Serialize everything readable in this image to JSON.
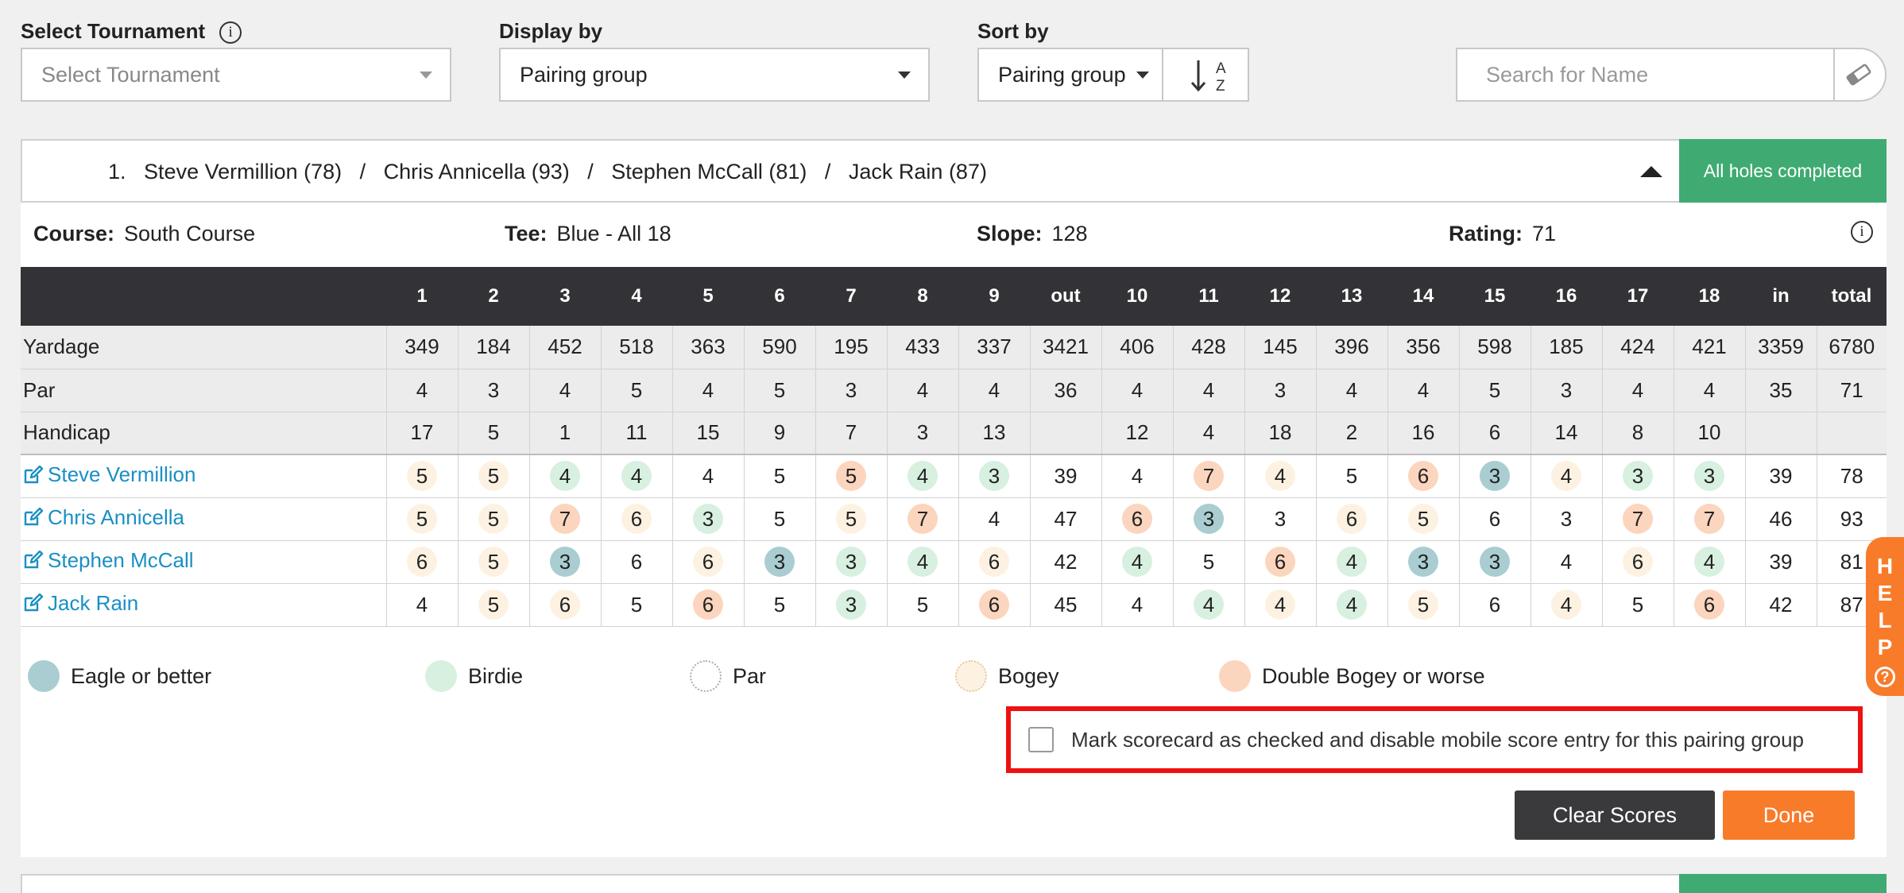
{
  "filters": {
    "tournament_label": "Select Tournament",
    "tournament_placeholder": "Select Tournament",
    "display_label": "Display by",
    "display_value": "Pairing group",
    "sort_label": "Sort by",
    "sort_value": "Pairing group",
    "sort_direction_top": "A",
    "sort_direction_bottom": "Z",
    "search_placeholder": "Search for Name"
  },
  "group": {
    "number": "1.",
    "players_line": "Steve Vermillion (78)   /   Chris Annicella (93)   /   Stephen McCall (81)   /   Jack Rain (87)",
    "status": "All holes completed"
  },
  "course_info": {
    "course_label": "Course:",
    "course_value": "South Course",
    "tee_label": "Tee:",
    "tee_value": "Blue - All 18",
    "slope_label": "Slope:",
    "slope_value": "128",
    "rating_label": "Rating:",
    "rating_value": "71"
  },
  "scorecard": {
    "columns": [
      "1",
      "2",
      "3",
      "4",
      "5",
      "6",
      "7",
      "8",
      "9",
      "out",
      "10",
      "11",
      "12",
      "13",
      "14",
      "15",
      "16",
      "17",
      "18",
      "in",
      "total"
    ],
    "info_rows": [
      {
        "label": "Yardage",
        "values": [
          "349",
          "184",
          "452",
          "518",
          "363",
          "590",
          "195",
          "433",
          "337",
          "3421",
          "406",
          "428",
          "145",
          "396",
          "356",
          "598",
          "185",
          "424",
          "421",
          "3359",
          "6780"
        ]
      },
      {
        "label": "Par",
        "values": [
          "4",
          "3",
          "4",
          "5",
          "4",
          "5",
          "3",
          "4",
          "4",
          "36",
          "4",
          "4",
          "3",
          "4",
          "4",
          "5",
          "3",
          "4",
          "4",
          "35",
          "71"
        ]
      },
      {
        "label": "Handicap",
        "values": [
          "17",
          "5",
          "1",
          "11",
          "15",
          "9",
          "7",
          "3",
          "13",
          "",
          "12",
          "4",
          "18",
          "2",
          "16",
          "6",
          "14",
          "8",
          "10",
          "",
          ""
        ]
      }
    ],
    "players": [
      {
        "name": "Steve Vermillion",
        "scores": [
          "5",
          "5",
          "4",
          "4",
          "4",
          "5",
          "5",
          "4",
          "3",
          "39",
          "4",
          "7",
          "4",
          "5",
          "6",
          "3",
          "4",
          "3",
          "3",
          "39",
          "78"
        ],
        "marks": [
          "bogey",
          "bogey",
          "birdie",
          "birdie",
          "",
          "",
          "double",
          "birdie",
          "birdie",
          "",
          "",
          "double",
          "bogey",
          "",
          "double",
          "eagle",
          "bogey",
          "birdie",
          "birdie",
          "",
          ""
        ]
      },
      {
        "name": "Chris Annicella",
        "scores": [
          "5",
          "5",
          "7",
          "6",
          "3",
          "5",
          "5",
          "7",
          "4",
          "47",
          "6",
          "3",
          "3",
          "6",
          "5",
          "6",
          "3",
          "7",
          "7",
          "46",
          "93"
        ],
        "marks": [
          "bogey",
          "bogey",
          "double",
          "bogey",
          "birdie",
          "",
          "bogey",
          "double",
          "",
          "",
          "double",
          "eagle",
          "",
          "bogey",
          "bogey",
          "",
          "",
          "double",
          "double",
          "",
          ""
        ]
      },
      {
        "name": "Stephen McCall",
        "scores": [
          "6",
          "5",
          "3",
          "6",
          "6",
          "3",
          "3",
          "4",
          "6",
          "42",
          "4",
          "5",
          "6",
          "4",
          "3",
          "3",
          "4",
          "6",
          "4",
          "39",
          "81"
        ],
        "marks": [
          "bogey",
          "bogey",
          "eagle",
          "",
          "bogey",
          "eagle",
          "birdie",
          "birdie",
          "bogey",
          "",
          "birdie",
          "",
          "double",
          "birdie",
          "eagle",
          "eagle",
          "",
          "bogey",
          "birdie",
          "",
          ""
        ]
      },
      {
        "name": "Jack Rain",
        "scores": [
          "4",
          "5",
          "6",
          "5",
          "6",
          "5",
          "3",
          "5",
          "6",
          "45",
          "4",
          "4",
          "4",
          "4",
          "5",
          "6",
          "4",
          "5",
          "6",
          "42",
          "87"
        ],
        "marks": [
          "",
          "bogey",
          "bogey",
          "",
          "double",
          "",
          "birdie",
          "",
          "double",
          "",
          "",
          "birdie",
          "bogey",
          "birdie",
          "bogey",
          "",
          "bogey",
          "",
          "double",
          "",
          ""
        ]
      }
    ]
  },
  "legend": {
    "eagle": "Eagle or better",
    "birdie": "Birdie",
    "par": "Par",
    "bogey": "Bogey",
    "double": "Double Bogey or worse"
  },
  "actions": {
    "mark_checked_label": "Mark scorecard as checked and disable mobile score entry for this pairing group",
    "mark_checked": false,
    "clear_label": "Clear Scores",
    "done_label": "Done"
  },
  "help": {
    "letters": [
      "H",
      "E",
      "L",
      "P"
    ],
    "icon": "question-icon"
  },
  "colors": {
    "eagle": "#a9cdd1",
    "birdie": "#d7f0e0",
    "bogey": "#fdf2e2",
    "double": "#fbd5bd",
    "accent_green": "#3fab72",
    "accent_orange": "#f87b2a",
    "link_blue": "#1a8fc4",
    "header_dark": "#333337"
  }
}
